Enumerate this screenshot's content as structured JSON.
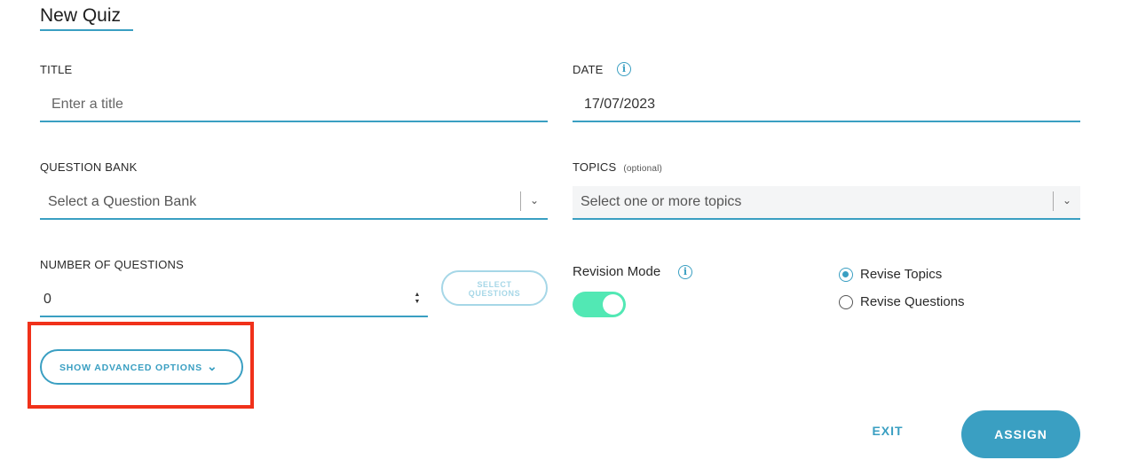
{
  "page": {
    "title": "New Quiz"
  },
  "form": {
    "title": {
      "label": "TITLE",
      "placeholder": "Enter a title",
      "value": ""
    },
    "date": {
      "label": "DATE",
      "value": "17/07/2023",
      "info_icon": "info-icon"
    },
    "question_bank": {
      "label": "QUESTION BANK",
      "placeholder": "Select a Question Bank"
    },
    "topics": {
      "label": "TOPICS",
      "optional": "(optional)",
      "placeholder": "Select one or more topics"
    },
    "num_questions": {
      "label": "NUMBER OF QUESTIONS",
      "value": "0"
    },
    "select_questions_button": {
      "line1": "SELECT",
      "line2": "QUESTIONS"
    },
    "revision_mode": {
      "label": "Revision Mode",
      "enabled": true
    },
    "revise_options": [
      {
        "label": "Revise Topics",
        "selected": true
      },
      {
        "label": "Revise Questions",
        "selected": false
      }
    ],
    "advanced": {
      "label": "SHOW ADVANCED OPTIONS"
    }
  },
  "actions": {
    "exit": "EXIT",
    "assign": "ASSIGN"
  },
  "colors": {
    "accent": "#3a9fc2",
    "toggle_on": "#52e8b4",
    "highlight": "#f0311a"
  }
}
